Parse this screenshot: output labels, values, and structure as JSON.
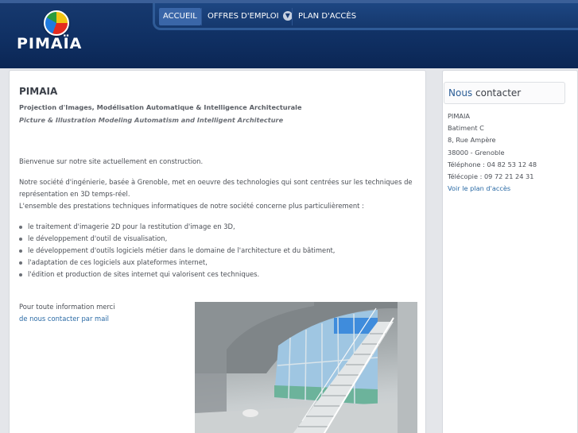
{
  "header": {
    "logo_text": "PIMAÏA"
  },
  "nav": {
    "items": [
      {
        "label": "ACCUEIL"
      },
      {
        "label": "OFFRES D'EMPLOI"
      },
      {
        "label": "PLAN D'ACCÈS"
      }
    ]
  },
  "main": {
    "title": "PIMAIA",
    "subtitle_fr": "Projection d'Images, Modélisation Automatique & Intelligence Architecturale",
    "subtitle_en": "Picture & Illustration Modeling Automatism and Intelligent Architecture",
    "welcome": "Bienvenue sur notre site actuellement en construction.",
    "intro_line1": "Notre société d'ingénierie, basée à Grenoble, met en oeuvre des technologies qui sont centrées sur les techniques de",
    "intro_line2": "représentation en 3D temps-réel.",
    "intro_line3": "L'ensemble des prestations techniques informatiques de notre société concerne plus particulièrement :",
    "services": [
      "le traitement d'imagerie 2D pour la restitution d'image en 3D,",
      "le développement d'outil de visualisation,",
      "le développement d'outils logiciels métier dans le domaine de l'architecture et du bâtiment,",
      "l'adaptation de ces logiciels aux plateformes internet,",
      "l'édition et production de sites internet qui valorisent ces techniques."
    ],
    "info_text": "Pour toute information merci",
    "contact_link": "de nous contacter par mail"
  },
  "sidebar": {
    "title_highlight": "Nous",
    "title_rest": "contacter",
    "name": "PIMAIA",
    "building": "Batiment C",
    "street": "8, Rue Ampère",
    "city": "38000 - Grenoble",
    "phone": "Téléphone : 04 82 53 12 48",
    "fax": "Télécopie : 09 72 21 24 31",
    "map_link": "Voir le plan d'accès"
  },
  "colors": {
    "header_bg": "#0f2f62",
    "nav_active": "#3a66a8",
    "link": "#2a6aa5",
    "title_accent": "#2a5d96"
  },
  "icons": {
    "logo": "color-ball-logo",
    "dropdown": "chevron-down-icon"
  }
}
